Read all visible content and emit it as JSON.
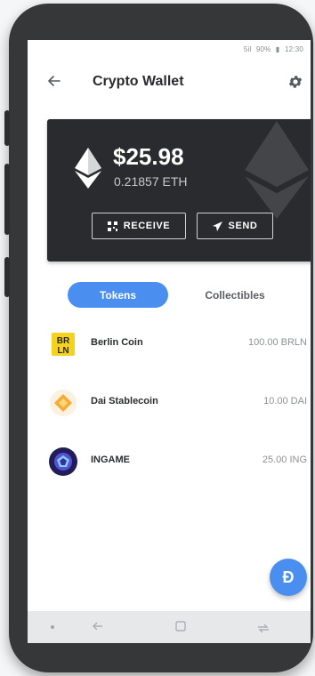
{
  "status_bar": {
    "signal": "5il",
    "battery": "90%",
    "time": "12:30"
  },
  "app_bar": {
    "back_icon": "back-arrow-icon",
    "title": "Crypto Wallet",
    "settings_icon": "gear-icon"
  },
  "balance_card": {
    "fiat_balance": "$25.98",
    "crypto_balance": "0.21857 ETH",
    "receive_label": "RECEIVE",
    "send_label": "SEND",
    "colors": {
      "card_bg": "#2a2b2e"
    }
  },
  "tabs": [
    {
      "label": "Tokens",
      "active": true
    },
    {
      "label": "Collectibles",
      "active": false
    }
  ],
  "tokens": [
    {
      "name": "Berlin Coin",
      "balance": "100.00 BRLN",
      "icon": "berlin-coin-icon",
      "icon_text": [
        "BR",
        "LN"
      ]
    },
    {
      "name": "Dai Stablecoin",
      "balance": "10.00 DAI",
      "icon": "dai-icon"
    },
    {
      "name": "INGAME",
      "balance": "25.00 ING",
      "icon": "ingame-icon"
    }
  ],
  "fab": {
    "label": "Ð"
  },
  "colors": {
    "accent": "#4a8ff0",
    "phone_frame": "#353739"
  }
}
